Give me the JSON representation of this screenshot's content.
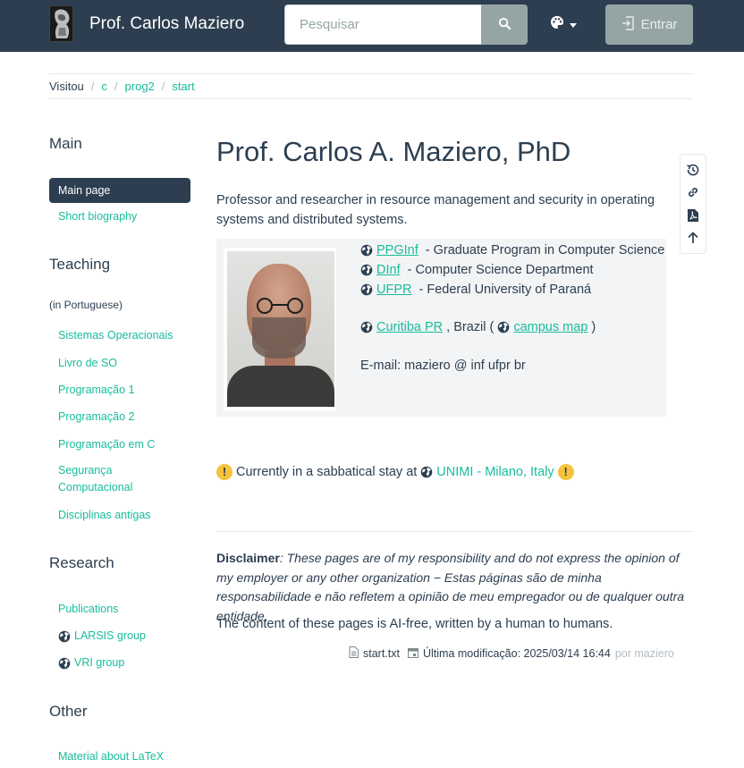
{
  "navbar": {
    "site_title": "Prof. Carlos Maziero",
    "search_placeholder": "Pesquisar",
    "login_label": "Entrar"
  },
  "breadcrumb": {
    "label": "Visitou",
    "items": [
      "c",
      "prog2",
      "start"
    ]
  },
  "sidebar": {
    "sections": [
      {
        "heading": "Main",
        "items": [
          "Main page",
          "Short biography"
        ]
      },
      {
        "heading": "Teaching",
        "note": "(in Portuguese)",
        "items": [
          "Sistemas Operacionais",
          "Livro de SO",
          "Programação 1",
          "Programação 2",
          "Programação em C",
          "Segurança Computacional",
          "Disciplinas antigas"
        ]
      },
      {
        "heading": "Research",
        "items": [
          "Publications",
          "LARSIS group",
          "VRI group"
        ]
      },
      {
        "heading": "Other",
        "items": [
          "Material about LaTeX"
        ]
      }
    ]
  },
  "main": {
    "title": "Prof. Carlos A. Maziero, PhD",
    "intro": "Professor and researcher in resource management and security in operating systems and distributed systems.",
    "profile": {
      "links": [
        {
          "link": "PPGInf",
          "text": " - Graduate Program in Computer Science"
        },
        {
          "link": "DInf",
          "text": " - Computer Science Department"
        },
        {
          "link": "UFPR",
          "text": " - Federal University of Paraná"
        }
      ],
      "city_link": "Curitiba PR",
      "city_text": ", Brazil (",
      "map_link": "campus map",
      "map_close": ")",
      "email": "E-mail: maziero @ inf ufpr br"
    },
    "sabbatical": {
      "text": "Currently in a sabbatical stay at",
      "link": "UNIMI - Milano, Italy"
    },
    "disclaimer": {
      "label": "Disclaimer",
      "text": ": These pages are of my responsibility and do not express the opinion of my employer or any other organization − Estas páginas são de minha responsabilidade e não refletem a opinião de meu empregador ou de qualquer outra entidade."
    },
    "ai_free": "The content of these pages is AI-free, written by a human to humans.",
    "doc_info": {
      "file": "start.txt",
      "modified": "Última modificação: 2025/03/14 16:44",
      "by": "por maziero"
    }
  },
  "colors": {
    "navbar": "#2c3e50",
    "accent": "#18bc9c",
    "muted_button": "#95a5a6",
    "warning": "#f5c33b"
  },
  "icons": [
    "logo",
    "search-icon",
    "palette-icon",
    "login-icon",
    "history-icon",
    "link-icon",
    "pdf-icon",
    "arrow-up-icon",
    "globe-icon",
    "warning-icon",
    "file-icon",
    "calendar-icon"
  ]
}
